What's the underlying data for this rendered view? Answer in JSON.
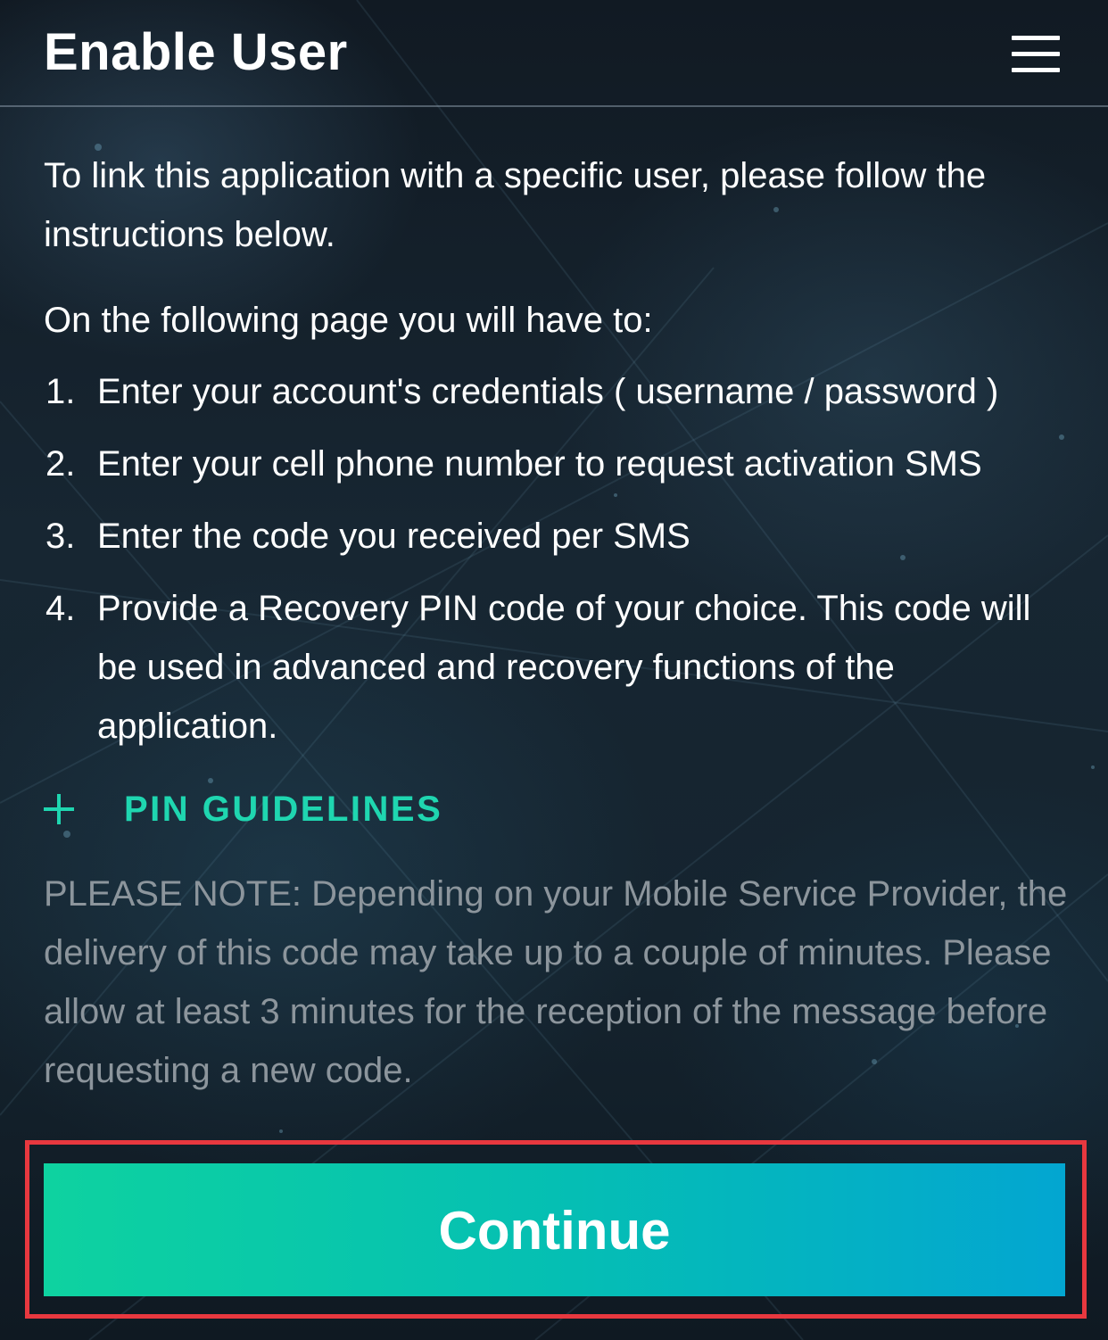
{
  "header": {
    "title": "Enable User",
    "menu_icon": "hamburger-menu-icon"
  },
  "main": {
    "intro": "To link this application with a specific user, please follow the instructions below.",
    "lead": "On the following page you will have to:",
    "steps": [
      {
        "number": "1.",
        "text": "Enter your account's credentials ( username / password )"
      },
      {
        "number": "2.",
        "text": "Enter your cell phone number to request activation SMS"
      },
      {
        "number": "3.",
        "text": "Enter the code you received per SMS"
      },
      {
        "number": "4.",
        "text": "Provide a Recovery PIN code of your choice. This code will be used in advanced and recovery functions of the application."
      }
    ],
    "pin_guidelines": {
      "icon": "plus-icon",
      "label": "PIN GUIDELINES"
    },
    "note": "PLEASE NOTE: Depending on your Mobile Service Provider, the delivery of this code may take up to a couple of minutes. Please allow at least 3 minutes for the reception of the message before requesting a new code."
  },
  "footer": {
    "continue_label": "Continue"
  },
  "colors": {
    "accent": "#1fd6b0",
    "button_gradient_start": "#0ed2a0",
    "button_gradient_end": "#03a6d1",
    "highlight_border": "#e8383f",
    "note_text": "#8c959c"
  }
}
